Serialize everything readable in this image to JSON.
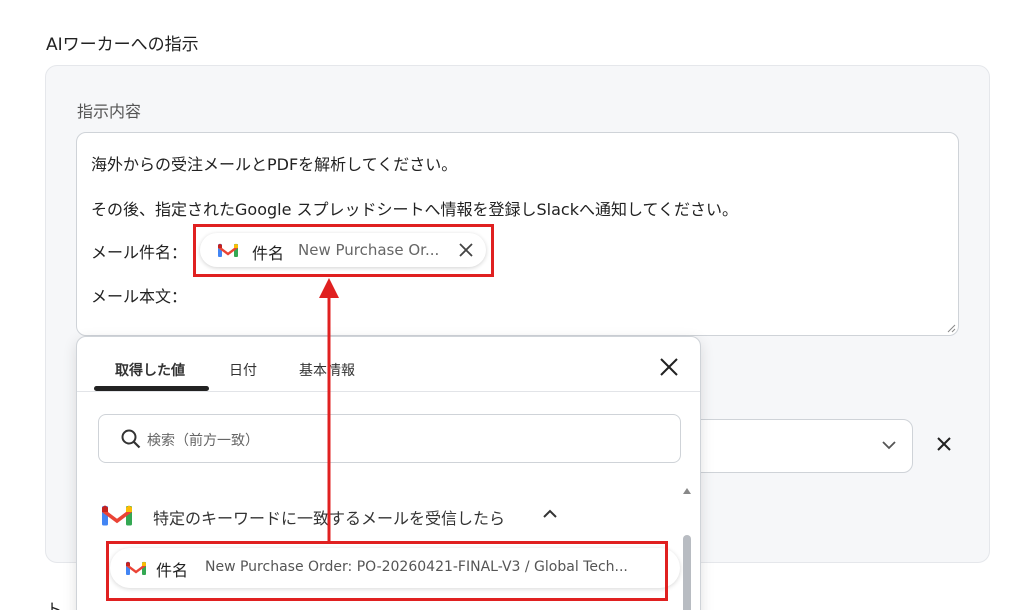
{
  "section_title": "AIワーカーへの指示",
  "instruction": {
    "label": "指示内容",
    "lines": [
      "海外からの受注メールとPDFを解析してください。",
      "その後、指定されたGoogle スプレッドシートへ情報を登録しSlackへ通知してください。",
      "メール件名：",
      "メール本文："
    ],
    "chip": {
      "icon": "gmail-icon",
      "key": "件名",
      "value": "New Purchase Or..."
    }
  },
  "dropdown": {
    "tabs": [
      "取得した値",
      "日付",
      "基本情報"
    ],
    "active_tab": "取得した値",
    "search_placeholder": "検索（前方一致）",
    "group": {
      "icon": "gmail-icon",
      "title": "特定のキーワードに一致するメールを受信したら",
      "expanded": true
    },
    "result": {
      "icon": "gmail-icon",
      "key": "件名",
      "value": "New Purchase Order: PO-20260421-FINAL-V3 / Global Tech..."
    }
  },
  "bottom_fragment": "ト",
  "colors": {
    "highlight": "#e02020",
    "panel_bg": "#f6f7f9",
    "gmail_red": "#EA4335",
    "gmail_blue": "#4285F4",
    "gmail_green": "#34A853",
    "gmail_yellow": "#FBBC04"
  }
}
